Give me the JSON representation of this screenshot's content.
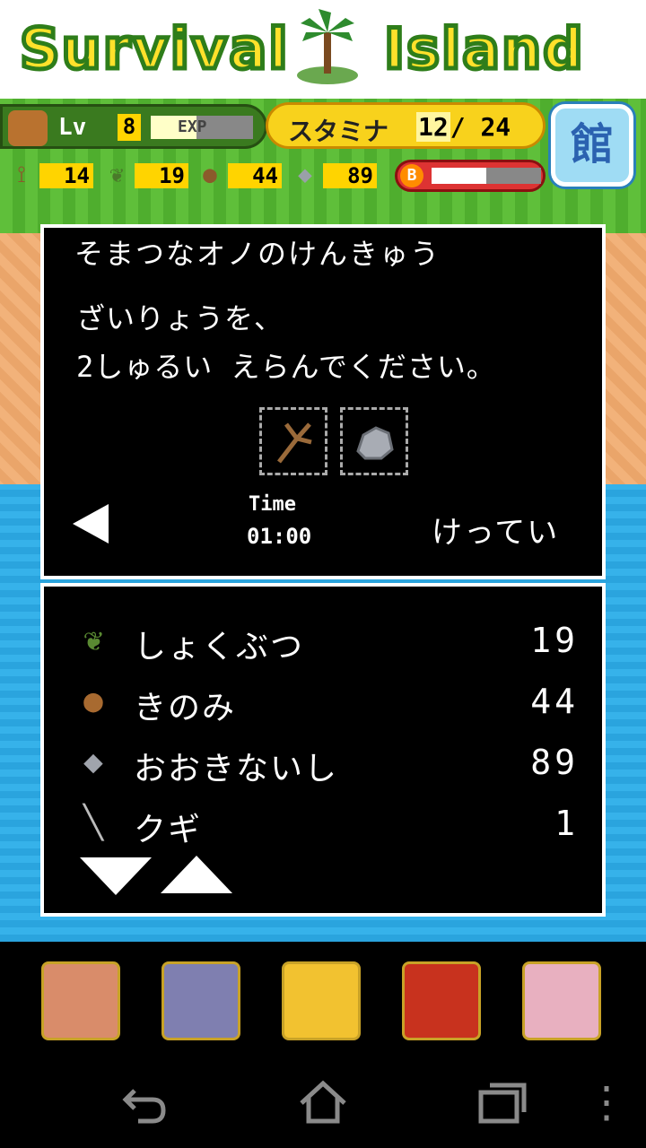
{
  "game": {
    "logo_left": "Survival",
    "logo_right": "Island"
  },
  "hud": {
    "lv_label": "Lv",
    "level": "8",
    "exp_label": "EXP",
    "exp_progress": 0.45,
    "stamina_label": "スタミナ",
    "stamina_current": "12",
    "stamina_max": "24",
    "book_label": "館",
    "b_coin_label": "B",
    "b_progress": 0.5
  },
  "resources": [
    {
      "icon": "branch-icon",
      "glyph": "⟟",
      "value": "14",
      "color": "#8b5a2b"
    },
    {
      "icon": "leaf-icon",
      "glyph": "❦",
      "value": "19",
      "color": "#4a7a2a"
    },
    {
      "icon": "nut-icon",
      "glyph": "●",
      "value": "44",
      "color": "#8b5a2b"
    },
    {
      "icon": "stone-icon",
      "glyph": "◆",
      "value": "89",
      "color": "#9aa0a8"
    }
  ],
  "dialog": {
    "title": "そまつなオノのけんきゅう",
    "line1": "ざいりょうを、",
    "line2": "2しゅるい えらんでください。",
    "time_label": "Time",
    "time_value": "01:00",
    "confirm_label": "けってい"
  },
  "materials": [
    {
      "icon": "leaf-icon",
      "glyph": "❦",
      "color": "#5a8a32",
      "name": "しょくぶつ",
      "count": "19"
    },
    {
      "icon": "nut-icon",
      "glyph": "●",
      "color": "#a86a30",
      "name": "きのみ",
      "count": "44"
    },
    {
      "icon": "stone-icon",
      "glyph": "◆",
      "color": "#a0a4ac",
      "name": "おおきないし",
      "count": "89"
    },
    {
      "icon": "nail-icon",
      "glyph": "╲",
      "color": "#bbbbbb",
      "name": "クギ",
      "count": "1"
    }
  ],
  "ads": [
    {
      "name": "ad-game-1",
      "color": "#d98c6a"
    },
    {
      "name": "ad-game-2",
      "color": "#7f7fb0"
    },
    {
      "name": "ad-game-3",
      "color": "#f2c230"
    },
    {
      "name": "ad-game-4",
      "color": "#c8321e"
    },
    {
      "name": "ad-game-5",
      "color": "#e8b0c0"
    }
  ]
}
